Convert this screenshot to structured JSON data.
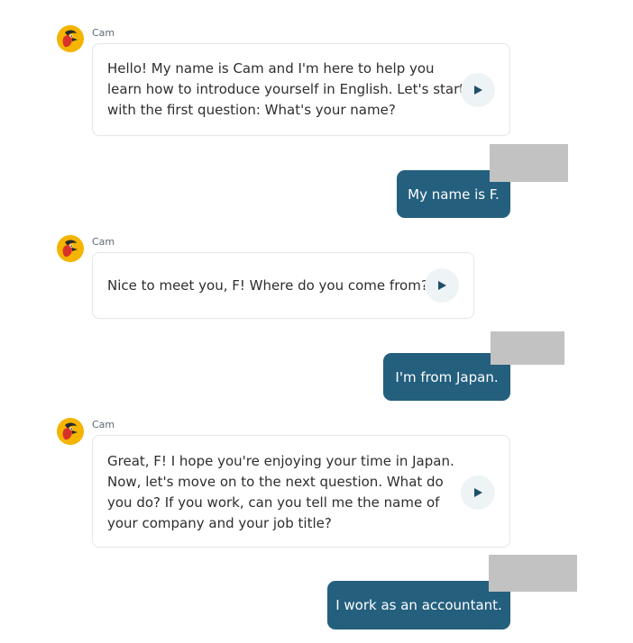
{
  "colors": {
    "user_bubble": "#245f7e",
    "bot_bubble_border": "#e3e8ec",
    "play_button_bg": "#eef3f6",
    "play_icon": "#1f4f6b",
    "redaction": "#c2c2c2",
    "avatar_yellow": "#f4b400",
    "avatar_red": "#d6322b"
  },
  "conversation": {
    "bot_name": "Cam",
    "messages": [
      {
        "role": "bot",
        "sender": "Cam",
        "lines": [
          "Hello! My name is Cam and I'm here to help you",
          "learn how to introduce yourself in English. Let's start",
          "with the first question: What's your name?"
        ],
        "play_icon": "play-icon"
      },
      {
        "role": "user",
        "text": "My name is F."
      },
      {
        "role": "bot",
        "sender": "Cam",
        "lines": [
          "Nice to meet you, F! Where do you come from?"
        ],
        "play_icon": "play-icon"
      },
      {
        "role": "user",
        "text": "I'm from Japan."
      },
      {
        "role": "bot",
        "sender": "Cam",
        "lines": [
          "Great, F! I hope you're enjoying your time in Japan.",
          "Now, let's move on to the next question. What do",
          "you do? If you work, can you tell me the name of",
          "your company and your job title?"
        ],
        "play_icon": "play-icon"
      },
      {
        "role": "user",
        "text": "I work as an accountant."
      }
    ]
  }
}
